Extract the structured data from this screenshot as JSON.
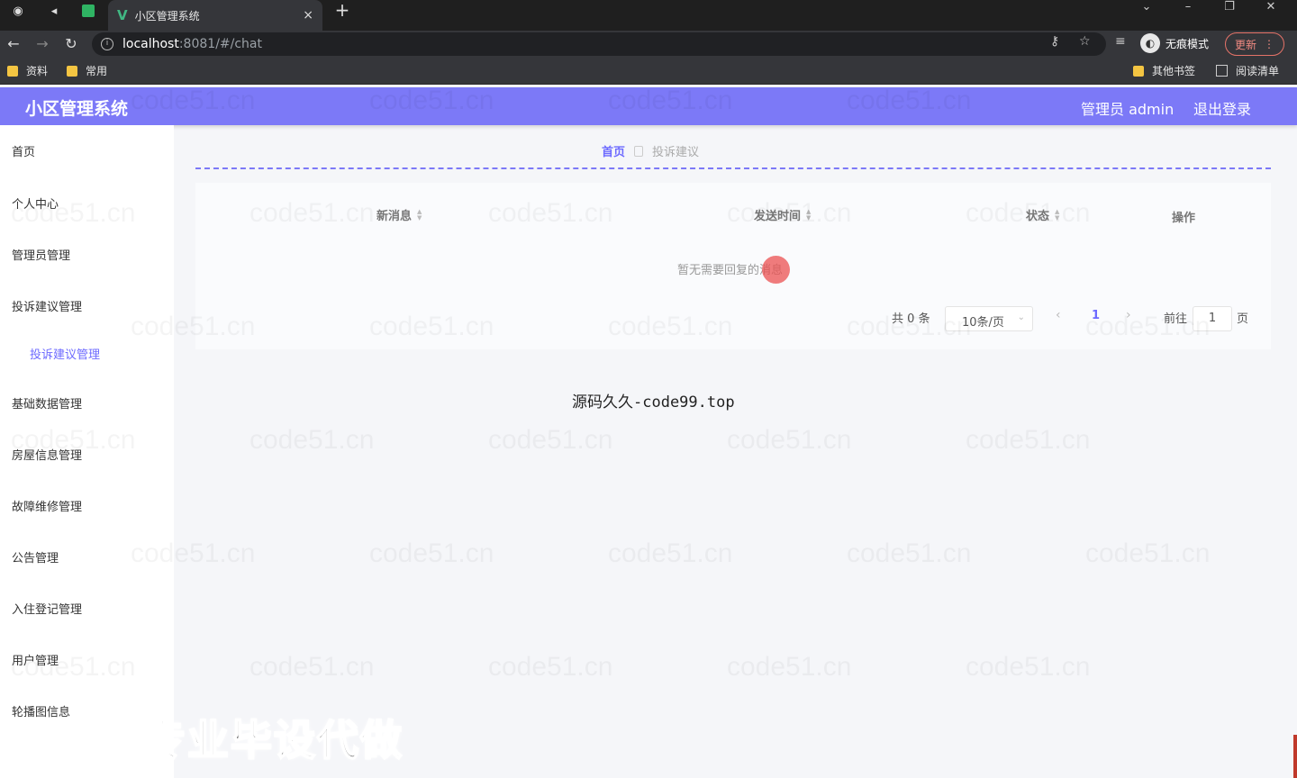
{
  "browser": {
    "tab_title": "小区管理系统",
    "tab_favicon": "V",
    "close_glyph": "×",
    "newtab_glyph": "+",
    "url_host": "localhost",
    "url_path": ":8081/#/chat",
    "incognito_label": "无痕模式",
    "update_label": "更新",
    "bookmarks": [
      "资料",
      "常用"
    ],
    "bookmarks_right": [
      "其他书签",
      "阅读清单"
    ]
  },
  "header": {
    "title": "小区管理系统",
    "user": "管理员 admin",
    "logout": "退出登录"
  },
  "sidebar": {
    "items": [
      "首页",
      "个人中心",
      "管理员管理",
      "投诉建议管理",
      "投诉建议管理",
      "基础数据管理",
      "房屋信息管理",
      "故障维修管理",
      "公告管理",
      "入住登记管理",
      "用户管理",
      "轮播图信息"
    ]
  },
  "breadcrumb": {
    "home": "首页",
    "current": "投诉建议"
  },
  "table": {
    "columns": [
      "新消息",
      "发送时间",
      "状态",
      "操作"
    ],
    "empty_text": "暂无需要回复的消息"
  },
  "pagination": {
    "total": "共 0 条",
    "page_size": "10条/页",
    "current_page": "1",
    "goto_label": "前往",
    "goto_value": "1",
    "page_suffix": "页"
  },
  "overlay": {
    "site_text": "源码久久-code99.top",
    "promo_text": "专业毕设代做",
    "watermark": "code51.cn"
  },
  "colors": {
    "accent": "#7c79f7",
    "link": "#6d6aff"
  }
}
